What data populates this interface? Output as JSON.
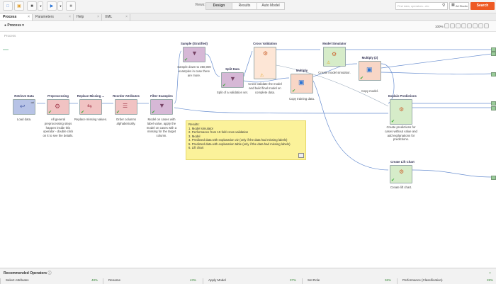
{
  "toolbar": {
    "views_label": "Views:",
    "view_tabs": [
      "Design",
      "Results",
      "Auto Model"
    ],
    "search_placeholder": "Find data, operators...etc",
    "studio_select": "All Studio",
    "search_button": "Search"
  },
  "panel_tabs": [
    "Process",
    "Parameters",
    "Help",
    "XML"
  ],
  "process_header": {
    "button": "Process",
    "zoom": "100%",
    "breadcrumb": "Process"
  },
  "operators": [
    {
      "title": "Retrieve Data",
      "desc": "Load data.",
      "color": "#b7c3e6"
    },
    {
      "title": "Preprocessing",
      "desc": "All general preprocessing steps happen inside this operator - double click on it to see the details.",
      "color": "#f1c3c3"
    },
    {
      "title": "Replace Missing ...",
      "desc": "Replace missing values.",
      "color": "#f1c3c3"
    },
    {
      "title": "Reorder Attributes",
      "desc": "Order columns alphabetically.",
      "color": "#f1c3c3"
    },
    {
      "title": "Filter Examples",
      "desc": "Model on cases with label value, apply the model on cases with a missing for the target column.",
      "color": "#d6b8d6"
    },
    {
      "title": "Sample (Stratified)",
      "desc": "Sample down to 250,000 examples in case there are more.",
      "color": "#d6b8d6"
    },
    {
      "title": "Split Data",
      "desc": "Split of a validation set.",
      "color": "#d6b8d6"
    },
    {
      "title": "Cross Validation",
      "desc": "Cross-validate the model and build final model on complete data.",
      "color": "#fde6d6"
    },
    {
      "title": "Multiply",
      "desc": "Copy training data.",
      "color": "#f8d6c6"
    },
    {
      "title": "Model Simulator",
      "desc": "Create model simulator.",
      "color": "#d6ecc9"
    },
    {
      "title": "Multiply (2)",
      "desc": "Copy model.",
      "color": "#f8d6c6"
    },
    {
      "title": "Explain Predictions",
      "desc": "Create predictions for cases without value and add explanations for predictions.",
      "color": "#d6ecc9"
    },
    {
      "title": "Create Lift Chart",
      "desc": "Create lift chart.",
      "color": "#d6ecc9"
    }
  ],
  "note": {
    "heading": "Results:",
    "lines": [
      "1. Model simulator",
      "2. Performance from 10-fold cross validation",
      "3. Model",
      "4. Predicted data with explanation viz (only if the data had missing labels)",
      "5. Predicted data with explanation table (only if the data had missing labels)",
      "6. Lift chart"
    ]
  },
  "recommended": {
    "heading": "Recommended Operators",
    "items": [
      {
        "label": "Select Attributes",
        "pct": "48%"
      },
      {
        "label": "Rename",
        "pct": "43%"
      },
      {
        "label": "Apply Model",
        "pct": "37%"
      },
      {
        "label": "Set Role",
        "pct": "36%"
      },
      {
        "label": "Performance (Classification)",
        "pct": "28%"
      }
    ]
  }
}
